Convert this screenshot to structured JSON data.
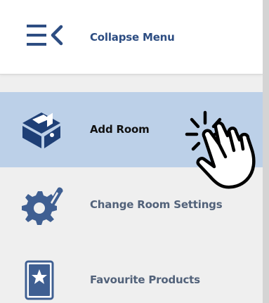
{
  "header": {
    "title": "Collapse Menu",
    "icon": "collapse-menu-icon"
  },
  "menu": {
    "items": [
      {
        "label": "Add Room",
        "icon": "add-room-icon",
        "active": true
      },
      {
        "label": "Change Room Settings",
        "icon": "room-settings-icon",
        "active": false
      },
      {
        "label": "Favourite Products",
        "icon": "favourite-products-icon",
        "active": false
      }
    ]
  },
  "cursor": {
    "icon": "hand-pointer-click-icon"
  },
  "colors": {
    "background": "#efefef",
    "header_background": "#ffffff",
    "active_background": "#bcd0e8",
    "header_text": "#2d4d82",
    "active_text": "#111111",
    "inactive_text": "#52627a",
    "active_icon": "#1e3f76",
    "inactive_icon": "#3f5f92"
  }
}
